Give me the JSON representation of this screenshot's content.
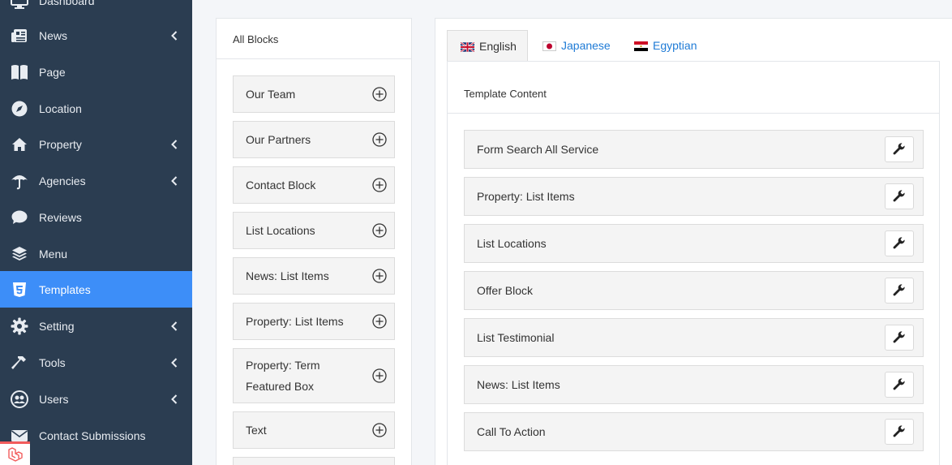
{
  "sidebar": {
    "items": [
      {
        "label": "Dashboard",
        "icon": "monitor-icon",
        "chevron": false
      },
      {
        "label": "News",
        "icon": "newspaper-icon",
        "chevron": true
      },
      {
        "label": "Page",
        "icon": "book-icon",
        "chevron": false
      },
      {
        "label": "Location",
        "icon": "compass-icon",
        "chevron": false
      },
      {
        "label": "Property",
        "icon": "home-icon",
        "chevron": true
      },
      {
        "label": "Agencies",
        "icon": "umbrella-icon",
        "chevron": true
      },
      {
        "label": "Reviews",
        "icon": "comment-icon",
        "chevron": false
      },
      {
        "label": "Menu",
        "icon": "layers-icon",
        "chevron": false
      },
      {
        "label": "Templates",
        "icon": "html5-icon",
        "chevron": false,
        "active": true
      },
      {
        "label": "Setting",
        "icon": "gear-icon",
        "chevron": true
      },
      {
        "label": "Tools",
        "icon": "hammer-icon",
        "chevron": true
      },
      {
        "label": "Users",
        "icon": "users-icon",
        "chevron": true
      },
      {
        "label": "Contact Submissions",
        "icon": "envelope-icon",
        "chevron": false
      }
    ],
    "badge_icon": "laravel-icon"
  },
  "blocks": {
    "title": "All Blocks",
    "items": [
      "Our Team",
      "Our Partners",
      "Contact Block",
      "List Locations",
      "News: List Items",
      "Property: List Items",
      "Property: Term Featured Box",
      "Text"
    ]
  },
  "tabs": [
    {
      "label": "English",
      "flag": "uk-flag-icon",
      "active": true
    },
    {
      "label": "Japanese",
      "flag": "japan-flag-icon",
      "active": false
    },
    {
      "label": "Egyptian",
      "flag": "egypt-flag-icon",
      "active": false
    }
  ],
  "template": {
    "title": "Template Content",
    "items": [
      "Form Search All Service",
      "Property: List Items",
      "List Locations",
      "Offer Block",
      "List Testimonial",
      "News: List Items",
      "Call To Action"
    ]
  },
  "colors": {
    "sidebar_bg": "#2b3d51",
    "active_bg": "#3d8ef8",
    "link": "#1f7bd6"
  }
}
